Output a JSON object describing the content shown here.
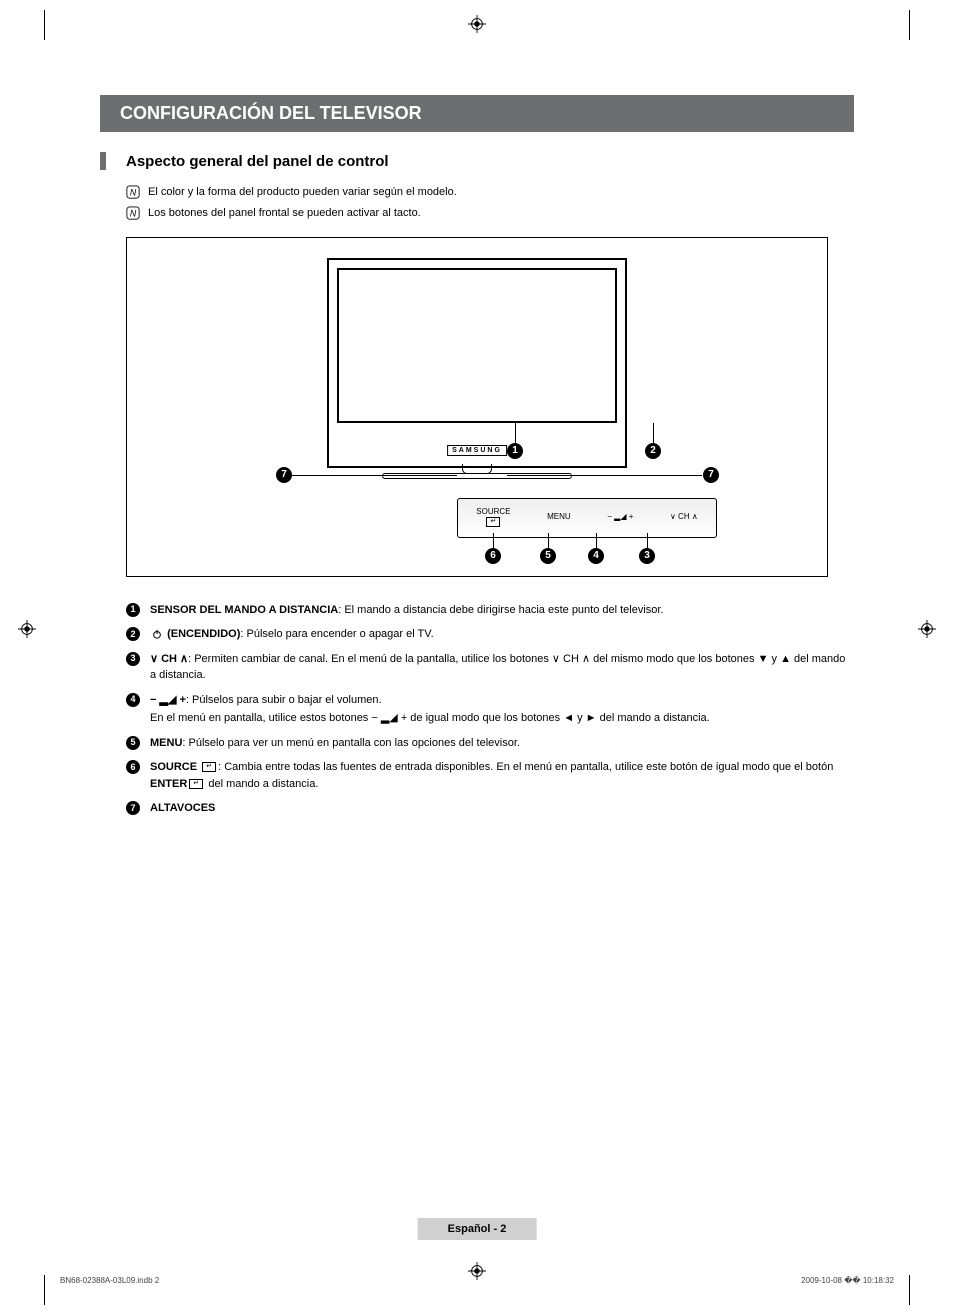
{
  "header": {
    "title": "CONFIGURACIÓN DEL TELEVISOR"
  },
  "subheading": "Aspecto general del panel de control",
  "notes": [
    "El color y la forma del producto pueden variar según el modelo.",
    "Los botones del panel frontal se pueden activar al tacto."
  ],
  "diagram": {
    "brand": "SAMSUNG",
    "panel_buttons": {
      "source": "SOURCE",
      "menu": "MENU",
      "volume": "− ▂◢ +",
      "channel": "∨ CH ∧"
    },
    "callouts": {
      "1": "1",
      "2": "2",
      "3": "3",
      "4": "4",
      "5": "5",
      "6": "6",
      "7l": "7",
      "7r": "7"
    }
  },
  "items": [
    {
      "num": "1",
      "label": "SENSOR DEL MANDO A DISTANCIA",
      "text": ": El mando a distancia debe dirigirse hacia este punto del televisor."
    },
    {
      "num": "2",
      "label_prefix_icon": "power",
      "label": "(ENCENDIDO)",
      "text": ": Púlselo para encender o apagar el TV."
    },
    {
      "num": "3",
      "label_prefix": "∨ CH ∧",
      "text": ": Permiten cambiar de canal. En el menú de la pantalla, utilice los botones ∨ CH ∧ del mismo modo que los botones ▼ y ▲ del mando a distancia."
    },
    {
      "num": "4",
      "label_prefix": "− ▂◢ +",
      "text": ": Púlselos para subir o bajar el volumen.",
      "sub": "En el menú en pantalla, utilice estos botones − ▂◢ + de igual modo que los botones ◄ y ► del mando a distancia."
    },
    {
      "num": "5",
      "label": "MENU",
      "text": ": Púlselo para ver un menú en pantalla con las opciones del televisor."
    },
    {
      "num": "6",
      "label": "SOURCE",
      "label_suffix_icon": "enter",
      "text": ": Cambia entre todas las fuentes de entrada disponibles. En el menú en pantalla, utilice este botón de igual modo que el botón ",
      "text_bold2": "ENTER",
      "text_suffix": " del mando a distancia."
    },
    {
      "num": "7",
      "label": "ALTAVOCES",
      "text": ""
    }
  ],
  "footer": {
    "lang": "Español - 2",
    "docref": "BN68-02388A-03L09.indb   2",
    "timestamp": "2009-10-08   �� 10:18:32"
  }
}
